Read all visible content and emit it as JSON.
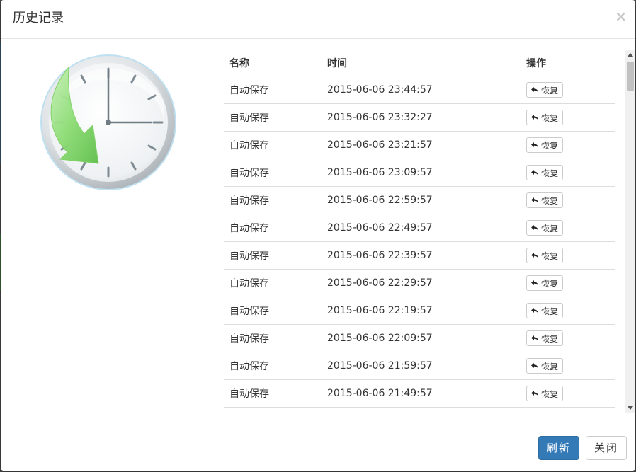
{
  "modal": {
    "title": "历史记录",
    "close_symbol": "×"
  },
  "table": {
    "headers": {
      "name": "名称",
      "time": "时间",
      "action": "操作"
    },
    "rows": [
      {
        "name": "自动保存",
        "time": "2015-06-06 23:44:57",
        "action": "恢复"
      },
      {
        "name": "自动保存",
        "time": "2015-06-06 23:32:27",
        "action": "恢复"
      },
      {
        "name": "自动保存",
        "time": "2015-06-06 23:21:57",
        "action": "恢复"
      },
      {
        "name": "自动保存",
        "time": "2015-06-06 23:09:57",
        "action": "恢复"
      },
      {
        "name": "自动保存",
        "time": "2015-06-06 22:59:57",
        "action": "恢复"
      },
      {
        "name": "自动保存",
        "time": "2015-06-06 22:49:57",
        "action": "恢复"
      },
      {
        "name": "自动保存",
        "time": "2015-06-06 22:39:57",
        "action": "恢复"
      },
      {
        "name": "自动保存",
        "time": "2015-06-06 22:29:57",
        "action": "恢复"
      },
      {
        "name": "自动保存",
        "time": "2015-06-06 22:19:57",
        "action": "恢复"
      },
      {
        "name": "自动保存",
        "time": "2015-06-06 22:09:57",
        "action": "恢复"
      },
      {
        "name": "自动保存",
        "time": "2015-06-06 21:59:57",
        "action": "恢复"
      },
      {
        "name": "自动保存",
        "time": "2015-06-06 21:49:57",
        "action": "恢复"
      }
    ],
    "row_action_icon": "undo-arrow-icon"
  },
  "footer": {
    "refresh_label": "刷新",
    "close_label": "关闭"
  },
  "illustration": {
    "icon": "history-clock-icon"
  },
  "colors": {
    "primary": "#337ab7",
    "border": "#dddddd",
    "backdrop": "#4a4a4a"
  }
}
